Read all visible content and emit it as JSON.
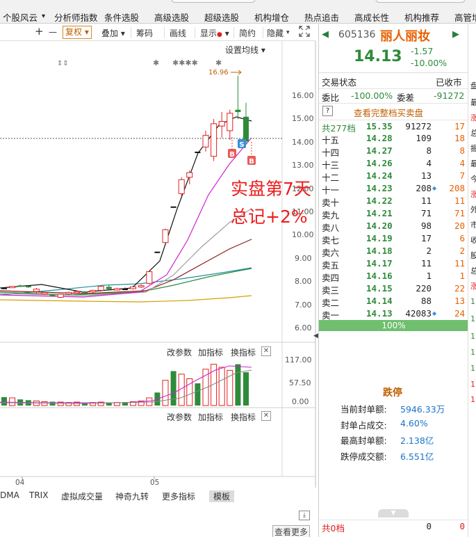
{
  "menu": {
    "tabs": [
      "个股风云",
      "分析师指数",
      "条件选股",
      "高级选股",
      "超级选股",
      "机构增仓",
      "热点追击",
      "高成长性",
      "机构推荐",
      "高管增"
    ]
  },
  "toolbar": {
    "plus": "+",
    "minus": "—",
    "fuquan": "复权",
    "diejia": "叠加",
    "chouma": "筹码",
    "huaxian": "画线",
    "xianshi": "显示",
    "jianyue": "简约",
    "yincang": "隐藏"
  },
  "chart": {
    "ma_setting": "设置均线",
    "high_label": "16.96",
    "overlay_line1": "实盘第7天",
    "overlay_line2": "总记+2%",
    "trade_marks": [
      "B",
      "S",
      "B"
    ],
    "date_labels": [
      "04",
      "05"
    ],
    "price_axis": [
      "16.00",
      "15.00",
      "14.00",
      "13.00",
      "12.00",
      "11.00",
      "10.00",
      "9.00",
      "8.00",
      "7.00",
      "6.00"
    ],
    "vol_axis": [
      "117.00",
      "57.50",
      "0.00"
    ],
    "ind1": {
      "gaicanshu": "改参数",
      "jiazhibiao": "加指标",
      "huanzhibiao": "换指标"
    },
    "ind2": {
      "gaicanshu": "改参数",
      "jiazhibiao": "加指标",
      "huanzhibiao": "换指标"
    },
    "close_glyph": "✕"
  },
  "chart_data": {
    "type": "candlestick",
    "title": "",
    "price_axis": [
      6,
      16
    ],
    "candles": [
      [
        7.86,
        7.86,
        7.86,
        7.86
      ],
      [
        7.9,
        7.94,
        7.86,
        7.92
      ],
      [
        7.96,
        8.0,
        7.9,
        7.95
      ],
      [
        7.94,
        7.94,
        7.85,
        7.88
      ],
      [
        7.7,
        7.85,
        7.6,
        7.8
      ],
      [
        7.62,
        7.68,
        7.55,
        7.65
      ],
      [
        7.56,
        7.58,
        7.5,
        7.5
      ],
      [
        7.45,
        7.6,
        7.42,
        7.58
      ],
      [
        7.6,
        7.7,
        7.55,
        7.66
      ],
      [
        7.68,
        7.75,
        7.6,
        7.7
      ],
      [
        7.7,
        7.72,
        7.66,
        7.68
      ],
      [
        7.7,
        7.78,
        7.65,
        7.75
      ],
      [
        7.75,
        7.95,
        7.7,
        7.92
      ],
      [
        7.9,
        8.0,
        7.78,
        7.8
      ],
      [
        7.8,
        7.86,
        7.76,
        7.82
      ],
      [
        7.82,
        7.88,
        7.78,
        7.82
      ],
      [
        7.82,
        7.95,
        7.78,
        7.9
      ],
      [
        7.92,
        8.0,
        7.85,
        7.95
      ],
      [
        8.05,
        8.6,
        8.0,
        8.55
      ],
      [
        9.41,
        9.41,
        9.41,
        9.41
      ],
      [
        9.8,
        10.4,
        9.8,
        10.35
      ],
      [
        11.35,
        11.35,
        11.35,
        11.35
      ],
      [
        11.9,
        12.6,
        11.8,
        12.5
      ],
      [
        12.6,
        12.9,
        12.3,
        12.8
      ],
      [
        13.7,
        13.7,
        13.7,
        13.7
      ],
      [
        13.9,
        14.6,
        13.7,
        14.4
      ],
      [
        13.5,
        15.1,
        13.3,
        14.9
      ],
      [
        14.8,
        15.4,
        14.3,
        15.0
      ],
      [
        14.6,
        15.5,
        14.2,
        15.35
      ],
      [
        15.5,
        16.96,
        15.1,
        15.4
      ],
      [
        15.2,
        15.8,
        14.0,
        14.13
      ]
    ],
    "volume_axis": [
      0,
      117
    ],
    "volume_last": 87,
    "legend": []
  },
  "bottom": {
    "tabs": [
      "DMA",
      "TRIX",
      "虚拟成交量",
      "神奇九转",
      "更多指标",
      "模板"
    ]
  },
  "stock": {
    "code": "605136",
    "name": "丽人丽妆",
    "price": "14.13",
    "change": "-1.57",
    "change_pct": "-10.00%",
    "trade_status_label": "交易状态",
    "trade_status": "已收市",
    "weibi_label": "委比",
    "weibi": "-100.00%",
    "weicha_label": "委差",
    "weicha": "-91272",
    "full_book": "查看完整档买卖盘",
    "help_glyph": "?",
    "total_label": "共277档",
    "total_price": "15.35",
    "total_vol": "91272",
    "total_cnt": "17",
    "bar_pct": "100%",
    "bottom_total_label": "共0档",
    "bottom_vol": "0",
    "bottom_cnt": "0"
  },
  "orderbook": [
    {
      "label": "十五",
      "price": "14.28",
      "vol": "109",
      "cnt": "18"
    },
    {
      "label": "十四",
      "price": "14.27",
      "vol": "8",
      "cnt": "8"
    },
    {
      "label": "十三",
      "price": "14.26",
      "vol": "4",
      "cnt": "4"
    },
    {
      "label": "十二",
      "price": "14.24",
      "vol": "13",
      "cnt": "7"
    },
    {
      "label": "十一",
      "price": "14.23",
      "vol": "208",
      "cnt": "208"
    },
    {
      "label": "卖十",
      "price": "14.22",
      "vol": "11",
      "cnt": "11"
    },
    {
      "label": "卖九",
      "price": "14.21",
      "vol": "71",
      "cnt": "71"
    },
    {
      "label": "卖八",
      "price": "14.20",
      "vol": "98",
      "cnt": "20"
    },
    {
      "label": "卖七",
      "price": "14.19",
      "vol": "17",
      "cnt": "6"
    },
    {
      "label": "卖六",
      "price": "14.18",
      "vol": "2",
      "cnt": "2"
    },
    {
      "label": "卖五",
      "price": "14.17",
      "vol": "11",
      "cnt": "11"
    },
    {
      "label": "卖四",
      "price": "14.16",
      "vol": "1",
      "cnt": "1"
    },
    {
      "label": "卖三",
      "price": "14.15",
      "vol": "220",
      "cnt": "22"
    },
    {
      "label": "卖二",
      "price": "14.14",
      "vol": "88",
      "cnt": "13"
    },
    {
      "label": "卖一",
      "price": "14.13",
      "vol": "42083",
      "cnt": "24"
    }
  ],
  "limitdown": {
    "title": "跌停",
    "rows": [
      {
        "label": "当前封单额:",
        "value": "5946.33万"
      },
      {
        "label": "封单占成交:",
        "value": "4.60%"
      },
      {
        "label": "最高封单额:",
        "value": "2.138亿"
      },
      {
        "label": "跌停成交额:",
        "value": "6.551亿"
      }
    ]
  },
  "more": {
    "view_more": "查看更多"
  },
  "colors": {
    "up": "#e02020",
    "down": "#2e8b3a",
    "accent": "#c06000",
    "blue": "#1a73c8"
  }
}
